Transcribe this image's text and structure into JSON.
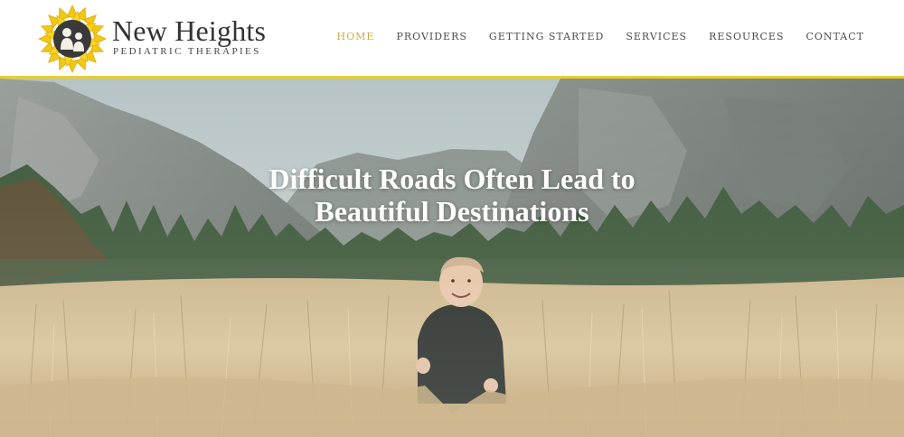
{
  "brand": {
    "name": "New Heights",
    "tagline": "PEDIATRIC THERAPIES",
    "logo_icon": "sunflower-silhouette-icon",
    "accent_color": "#e8cf2e"
  },
  "nav": {
    "active_color": "#c9ad43",
    "items": [
      {
        "label": "HOME",
        "active": true
      },
      {
        "label": "PROVIDERS",
        "active": false
      },
      {
        "label": "GETTING STARTED",
        "active": false
      },
      {
        "label": "SERVICES",
        "active": false
      },
      {
        "label": "RESOURCES",
        "active": false
      },
      {
        "label": "CONTACT",
        "active": false
      }
    ]
  },
  "hero": {
    "headline_line1": "Difficult Roads Often Lead to",
    "headline_line2": "Beautiful Destinations",
    "image_subject": "toddler-in-golden-meadow-photo"
  }
}
